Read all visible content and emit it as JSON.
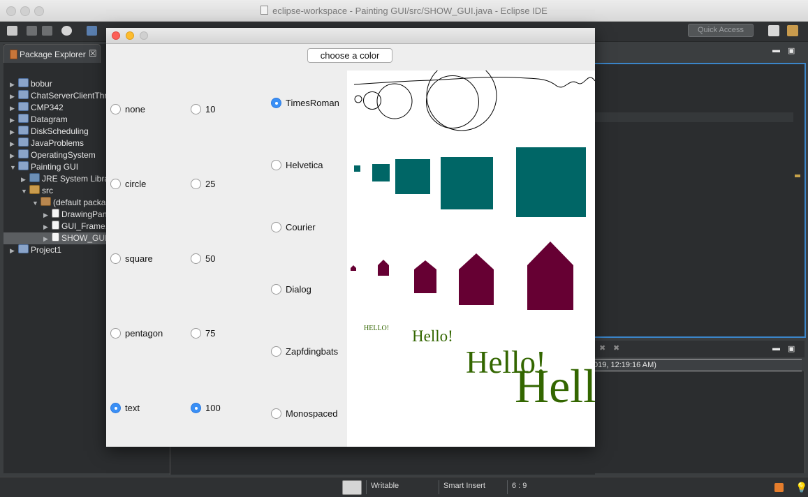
{
  "window": {
    "title": "eclipse-workspace - Painting GUI/src/SHOW_GUI.java - Eclipse IDE",
    "quick_access": "Quick Access"
  },
  "package_explorer": {
    "tab_label": "Package Explorer",
    "items": [
      {
        "label": "bobur",
        "icon": "project-icon",
        "expanded": false
      },
      {
        "label": "ChatServerClientThre",
        "icon": "project-icon",
        "expanded": false
      },
      {
        "label": "CMP342",
        "icon": "project-icon",
        "expanded": false
      },
      {
        "label": "Datagram",
        "icon": "project-icon",
        "expanded": false
      },
      {
        "label": "DiskScheduling",
        "icon": "project-icon",
        "expanded": false
      },
      {
        "label": "JavaProblems",
        "icon": "project-icon",
        "expanded": false
      },
      {
        "label": "OperatingSystem",
        "icon": "project-icon",
        "expanded": false
      },
      {
        "label": "Painting GUI",
        "icon": "project-icon",
        "expanded": true
      },
      {
        "label": "JRE System Libra",
        "icon": "library-icon",
        "expanded": false
      },
      {
        "label": "src",
        "icon": "source-folder-icon",
        "expanded": true
      },
      {
        "label": "(default packa",
        "icon": "package-icon",
        "expanded": true
      },
      {
        "label": "DrawingPan",
        "icon": "java-file-icon",
        "expanded": false
      },
      {
        "label": "GUI_Frame.",
        "icon": "java-file-icon",
        "expanded": false
      },
      {
        "label": "SHOW_GUI.",
        "icon": "java-file-icon",
        "expanded": false,
        "selected": true
      },
      {
        "label": "Project1",
        "icon": "project-icon",
        "expanded": false
      }
    ]
  },
  "console": {
    "status_text": "019, 12:19:16 AM)"
  },
  "statusbar": {
    "writable": "Writable",
    "insert_mode": "Smart Insert",
    "position": "6 : 9"
  },
  "app": {
    "color_button": "choose a color",
    "shape_options": [
      {
        "label": "none",
        "checked": false
      },
      {
        "label": "circle",
        "checked": false
      },
      {
        "label": "square",
        "checked": false
      },
      {
        "label": "pentagon",
        "checked": false
      },
      {
        "label": "text",
        "checked": true
      }
    ],
    "size_options": [
      {
        "label": "10",
        "checked": false
      },
      {
        "label": "25",
        "checked": false
      },
      {
        "label": "50",
        "checked": false
      },
      {
        "label": "75",
        "checked": false
      },
      {
        "label": "100",
        "checked": true
      }
    ],
    "font_options": [
      {
        "label": "TimesRoman",
        "checked": true
      },
      {
        "label": "Helvetica",
        "checked": false
      },
      {
        "label": "Courier",
        "checked": false
      },
      {
        "label": "Dialog",
        "checked": false
      },
      {
        "label": "Zapfdingbats",
        "checked": false
      },
      {
        "label": "Monospaced",
        "checked": false
      }
    ],
    "canvas": {
      "square_color": "#006666",
      "pentagon_color": "#660033",
      "text_color": "#336600",
      "text_samples": [
        "HELLO!",
        "Hello!",
        "Hello!",
        "Hello!"
      ]
    }
  }
}
